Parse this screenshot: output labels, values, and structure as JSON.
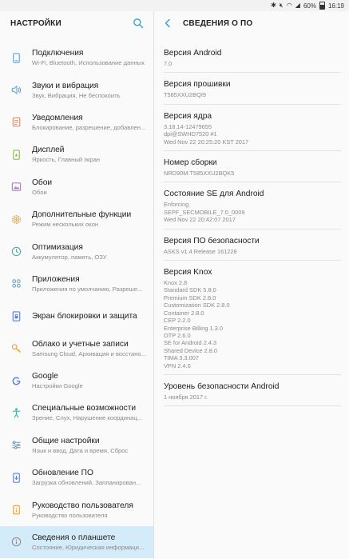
{
  "status": {
    "battery": "60%",
    "time": "16:19"
  },
  "left_panel": {
    "title": "НАСТРОЙКИ",
    "items": [
      {
        "title": "Подключения",
        "subtitle": "Wi-Fi, Bluetooth, Использование данных",
        "icon": "connections-icon",
        "color": "#5aa7d6"
      },
      {
        "title": "Звуки и вибрация",
        "subtitle": "Звук, Вибрация, Не беспокоить",
        "icon": "volume-icon",
        "color": "#5aa7d6"
      },
      {
        "title": "Уведомления",
        "subtitle": "Блокирование, разрешение, добавлен...",
        "icon": "notifications-icon",
        "color": "#e58a6b"
      },
      {
        "title": "Дисплей",
        "subtitle": "Яркость, Главный экран",
        "icon": "display-icon",
        "color": "#8fbc50"
      },
      {
        "title": "Обои",
        "subtitle": "Обои",
        "icon": "wallpaper-icon",
        "color": "#b07fc3"
      },
      {
        "title": "Дополнительные функции",
        "subtitle": "Режим нескольких окон",
        "icon": "gear-plus-icon",
        "color": "#e6a33c"
      },
      {
        "title": "Оптимизация",
        "subtitle": "Аккумулятор, память, ОЗУ",
        "icon": "optimization-icon",
        "color": "#3fb3a6"
      },
      {
        "title": "Приложения",
        "subtitle": "Приложения по умолчанию, Разреше...",
        "icon": "apps-icon",
        "color": "#5aa7d6"
      },
      {
        "title": "Экран блокировки и защита",
        "subtitle": "",
        "icon": "lock-icon",
        "color": "#5a7fd6"
      },
      {
        "title": "Облако и учетные записи",
        "subtitle": "Samsung Cloud, Архивация и восстано...",
        "icon": "key-icon",
        "color": "#e6a33c"
      },
      {
        "title": "Google",
        "subtitle": "Настройки Google",
        "icon": "google-icon",
        "color": "#5a7fd6"
      },
      {
        "title": "Специальные возможности",
        "subtitle": "Зрение, Слух, Нарушение координац...",
        "icon": "accessibility-icon",
        "color": "#3fb3a6"
      },
      {
        "title": "Общие настройки",
        "subtitle": "Язык и ввод, Дата и время, Сброс",
        "icon": "sliders-icon",
        "color": "#6a8fa8"
      },
      {
        "title": "Обновление ПО",
        "subtitle": "Загрузка обновлений, Запланирован...",
        "icon": "update-icon",
        "color": "#5a7fd6"
      },
      {
        "title": "Руководство пользователя",
        "subtitle": "Руководство пользователя",
        "icon": "manual-icon",
        "color": "#e6a33c"
      },
      {
        "title": "Сведения о планшете",
        "subtitle": "Состояние, Юридическая информаци...",
        "icon": "info-icon",
        "color": "#8a8a8a",
        "active": true
      }
    ]
  },
  "right_panel": {
    "title": "СВЕДЕНИЯ О ПО",
    "sections": [
      {
        "title": "Версия Android",
        "value": "7.0"
      },
      {
        "title": "Версия прошивки",
        "value": "T585XXU2BQI9"
      },
      {
        "title": "Версия ядра",
        "value": "3.18.14-12479655\ndpi@SWHD7520 #1\nWed Nov 22 20:25:20 KST 2017"
      },
      {
        "title": "Номер сборки",
        "value": "NRD90M.T585XXU2BQK5"
      },
      {
        "title": "Состояние SE для Android",
        "value": "Enforcing\nSEPF_SECMOBILE_7.0_0009\nWed Nov 22 20:42:07 2017"
      },
      {
        "title": "Версия ПО безопасности",
        "value": "ASKS v1.4 Release 161228"
      },
      {
        "title": "Версия Knox",
        "value": "Knox 2.8\nStandard SDK 5.8.0\nPremium SDK 2.8.0\nCustomization SDK 2.8.0\nContainer 2.8.0\nCEP 2.2.0\nEnterprise Billing 1.3.0\nOTP 2.6.0\nSE for Android 2.4.3\nShared Device 2.8.0\nTIMA 3.3.007\nVPN 2.4.0"
      },
      {
        "title": "Уровень безопасности Android",
        "value": "1 ноября 2017 г."
      }
    ]
  }
}
